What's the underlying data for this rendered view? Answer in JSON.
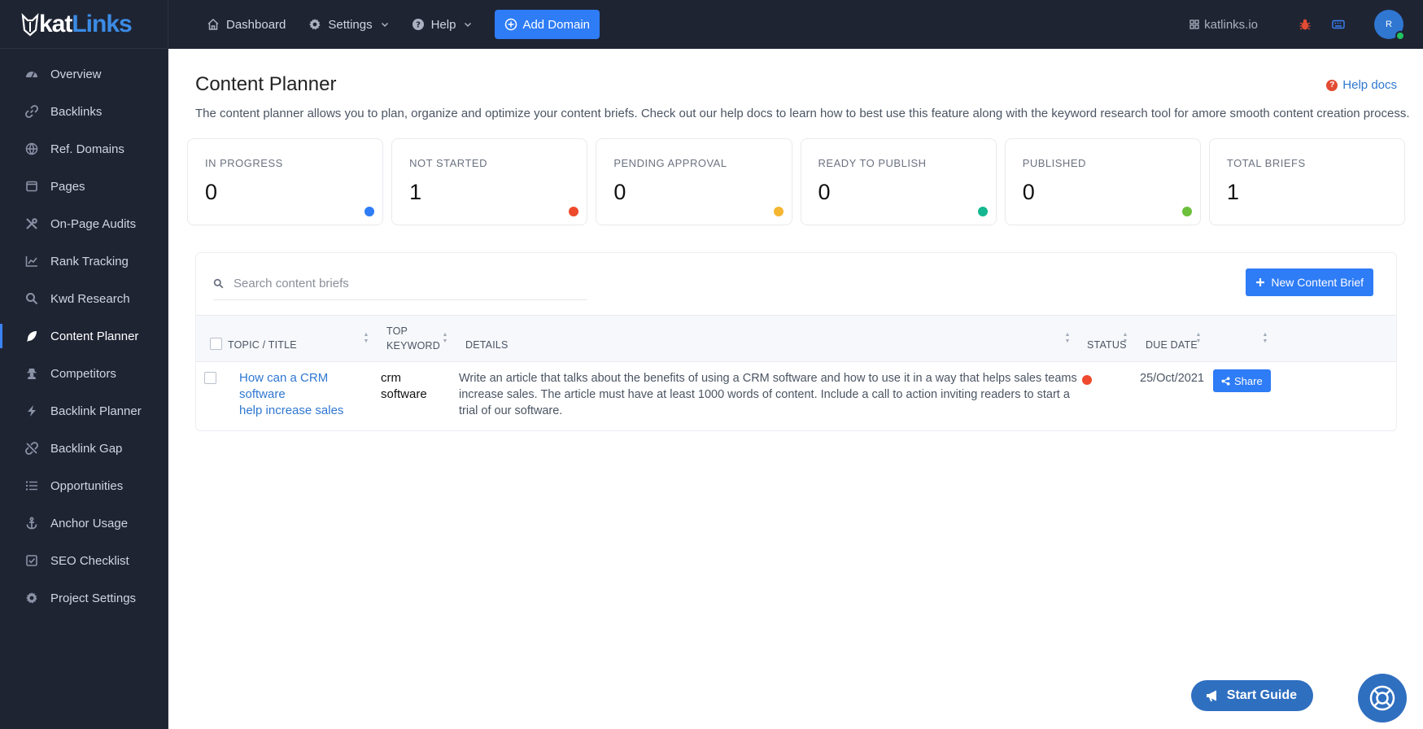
{
  "brand": {
    "logo_text_a": "kat",
    "logo_text_b": "Links",
    "accent": "#2e7cf6",
    "sidebar_bg": "#1f2433"
  },
  "sidebar": {
    "items": [
      {
        "label": "Overview",
        "icon": "gauge-icon"
      },
      {
        "label": "Backlinks",
        "icon": "link-icon"
      },
      {
        "label": "Ref. Domains",
        "icon": "globe-icon"
      },
      {
        "label": "Pages",
        "icon": "page-icon"
      },
      {
        "label": "On-Page Audits",
        "icon": "tools-icon"
      },
      {
        "label": "Rank Tracking",
        "icon": "chart-line-icon"
      },
      {
        "label": "Kwd Research",
        "icon": "search-icon"
      },
      {
        "label": "Content Planner",
        "icon": "feather-icon",
        "active": true
      },
      {
        "label": "Competitors",
        "icon": "user-secret-icon"
      },
      {
        "label": "Backlink Planner",
        "icon": "bolt-icon"
      },
      {
        "label": "Backlink Gap",
        "icon": "unlink-icon"
      },
      {
        "label": "Opportunities",
        "icon": "list-icon"
      },
      {
        "label": "Anchor Usage",
        "icon": "anchor-icon"
      },
      {
        "label": "SEO Checklist",
        "icon": "checklist-icon"
      },
      {
        "label": "Project Settings",
        "icon": "gear-icon"
      }
    ]
  },
  "topbar": {
    "dashboard": "Dashboard",
    "settings": "Settings",
    "help": "Help",
    "add_domain": "Add Domain",
    "site": "katlinks.io",
    "avatar_initial": "R"
  },
  "page": {
    "title": "Content Planner",
    "help_docs": "Help docs",
    "description": "The content planner allows you to plan, organize and optimize your content briefs. Check out our help docs to learn how to best use this feature along with the keyword research tool for amore smooth content creation process."
  },
  "stats": [
    {
      "label": "IN PROGRESS",
      "value": "0",
      "color": "#2e7cf6"
    },
    {
      "label": "NOT STARTED",
      "value": "1",
      "color": "#ee4a2d"
    },
    {
      "label": "PENDING APPROVAL",
      "value": "0",
      "color": "#f5b731"
    },
    {
      "label": "READY TO PUBLISH",
      "value": "0",
      "color": "#14b890"
    },
    {
      "label": "PUBLISHED",
      "value": "0",
      "color": "#6cc13c"
    },
    {
      "label": "TOTAL BRIEFS",
      "value": "1",
      "color": null
    }
  ],
  "table": {
    "search_placeholder": "Search content briefs",
    "new_brief_label": "New Content Brief",
    "headers": {
      "topic": "TOPIC / TITLE",
      "keyword_line1": "TOP",
      "keyword_line2": "KEYWORD",
      "details": "DETAILS",
      "status": "STATUS",
      "due_date": "DUE DATE"
    },
    "rows": [
      {
        "topic_line1": "How can a CRM software",
        "topic_line2": "help increase sales",
        "keyword_line1": "crm",
        "keyword_line2": "software",
        "details": "Write an article that talks about the benefits of using a CRM software and how to use it in a way that helps sales teams increase sales. The article must have at least 1000 words of content. Include a call to action inviting readers to start a trial of our software.",
        "status_color": "#ee4a2d",
        "due_date": "25/Oct/2021",
        "share_label": "Share"
      }
    ]
  },
  "widgets": {
    "start_guide": "Start Guide"
  }
}
